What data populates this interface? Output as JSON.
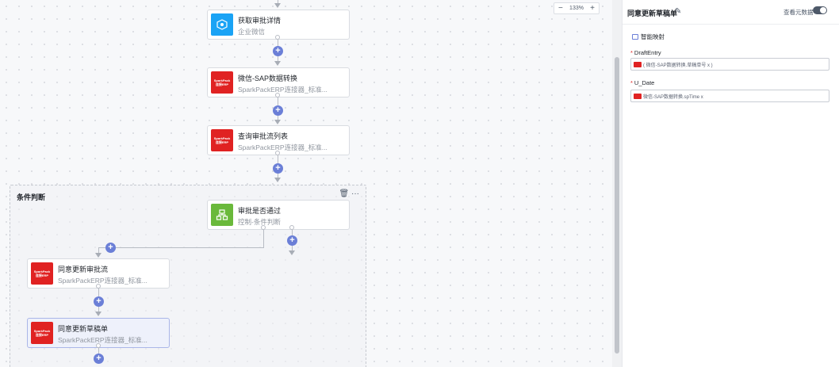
{
  "zoom": {
    "minus": "−",
    "level": "133%",
    "plus": "+"
  },
  "nodes": {
    "n1": {
      "title": "获取审批详情",
      "subtitle": "企业微信"
    },
    "n2": {
      "title": "微信-SAP数据转换",
      "subtitle": "SparkPackERP连接器_标准..."
    },
    "n3": {
      "title": "查询审批流列表",
      "subtitle": "SparkPackERP连接器_标准..."
    },
    "n4": {
      "title": "审批是否通过",
      "subtitle": "控制-条件判断"
    },
    "n5": {
      "title": "同意更新审批流",
      "subtitle": "SparkPackERP连接器_标准..."
    },
    "n6": {
      "title": "同意更新草稿单",
      "subtitle": "SparkPackERP连接器_标准..."
    }
  },
  "sp_logo": {
    "line1": "SparkPack",
    "line2": "连接ERP"
  },
  "group": {
    "title": "条件判断",
    "delete_icon": "🗑",
    "more_icon": "···"
  },
  "panel": {
    "title": "同意更新草稿单",
    "edit_icon": "✎",
    "meta_label": "查看元数据",
    "smart_mapping": "智能映射",
    "fields": [
      {
        "required": "*",
        "label": "DraftEntry",
        "value": "( 微信-SAP数据转换.草稿单号 x )"
      },
      {
        "required": "*",
        "label": "U_Date",
        "value": "微信-SAP数据转换.spTime x"
      }
    ]
  },
  "colors": {
    "accent": "#6b7fd7",
    "sparkpack": "#e02222",
    "wecom": "#1aa3f5",
    "condition": "#6ab93b"
  }
}
